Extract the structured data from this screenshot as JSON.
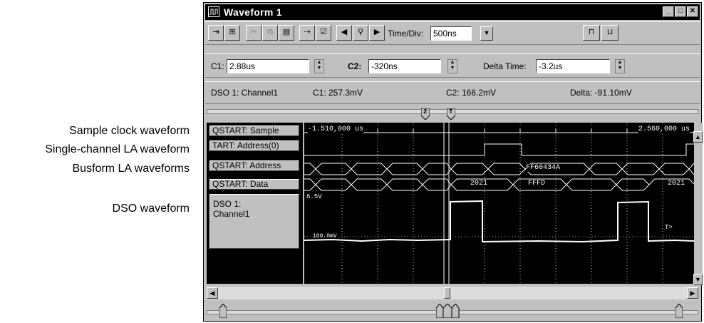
{
  "annotations": [
    "Sample clock waveform",
    "Single-channel LA waveform",
    "Busform LA waveforms",
    "DSO waveform"
  ],
  "window": {
    "title": "Waveform 1",
    "title_icon": "waveform-window-icon"
  },
  "toolbar": {
    "time_div_label": "Time/Div:",
    "time_div_value": "500ns"
  },
  "cursors": {
    "c1_label": "C1:",
    "c1_value": "2.88us",
    "c2_label": "C2:",
    "c2_value": "-320ns",
    "delta_label": "Delta Time:",
    "delta_value": "-3.2us"
  },
  "readout": {
    "source": "DSO 1: Channel1",
    "c1": "C1: 257.3mV",
    "c2": "C2: 166.2mV",
    "delta": "Delta: -91.10mV"
  },
  "ruler": {
    "marker_2": "2",
    "marker_t": "T"
  },
  "waveforms": {
    "names": [
      "QSTART: Sample",
      "TART: Address(0)",
      "QSTART: Address",
      "QSTART: Data"
    ],
    "dso_name": "DSO 1: Channel1",
    "time_left": "-1.510,000 us",
    "time_right": "2.560,000 us",
    "address_value": "FF60434A",
    "data_values": [
      "2021",
      "FFFD",
      "2021"
    ],
    "dso_top_label": "6.5V",
    "dso_mid_label": "100.0mV",
    "trigger_label": "T>"
  },
  "colors": {
    "plot_bg": "#000000",
    "trace": "#ffffff",
    "chrome": "#c0c0c0"
  }
}
